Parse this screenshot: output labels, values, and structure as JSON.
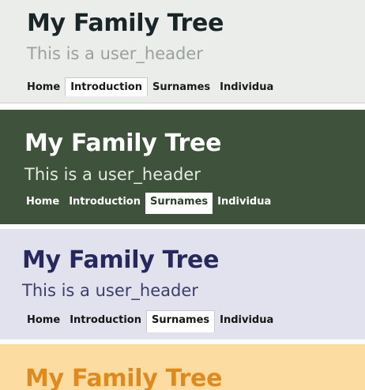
{
  "panels": [
    {
      "title": "My Family Tree",
      "subtitle": "This is a user_header",
      "tabs": [
        "Home",
        "Introduction",
        "Surnames",
        "Individua"
      ],
      "active_tab": "Introduction",
      "colors": {
        "background": "#ebedea",
        "title": "#1a2528",
        "subtitle": "#9aa0a0"
      }
    },
    {
      "title": "My Family Tree",
      "subtitle": "This is a user_header",
      "tabs": [
        "Home",
        "Introduction",
        "Surnames",
        "Individua"
      ],
      "active_tab": "Surnames",
      "colors": {
        "background": "#3f533c",
        "title": "#ffffff",
        "subtitle": "#e4ebe2"
      }
    },
    {
      "title": "My Family Tree",
      "subtitle": "This is a user_header",
      "tabs": [
        "Home",
        "Introduction",
        "Surnames",
        "Individua"
      ],
      "active_tab": "Surnames",
      "colors": {
        "background": "#e2e2ee",
        "title": "#27285e",
        "subtitle": "#3b3d6a"
      }
    },
    {
      "title": "My Family Tree",
      "colors": {
        "background": "#fddca2",
        "title": "#e08a1e"
      }
    }
  ]
}
